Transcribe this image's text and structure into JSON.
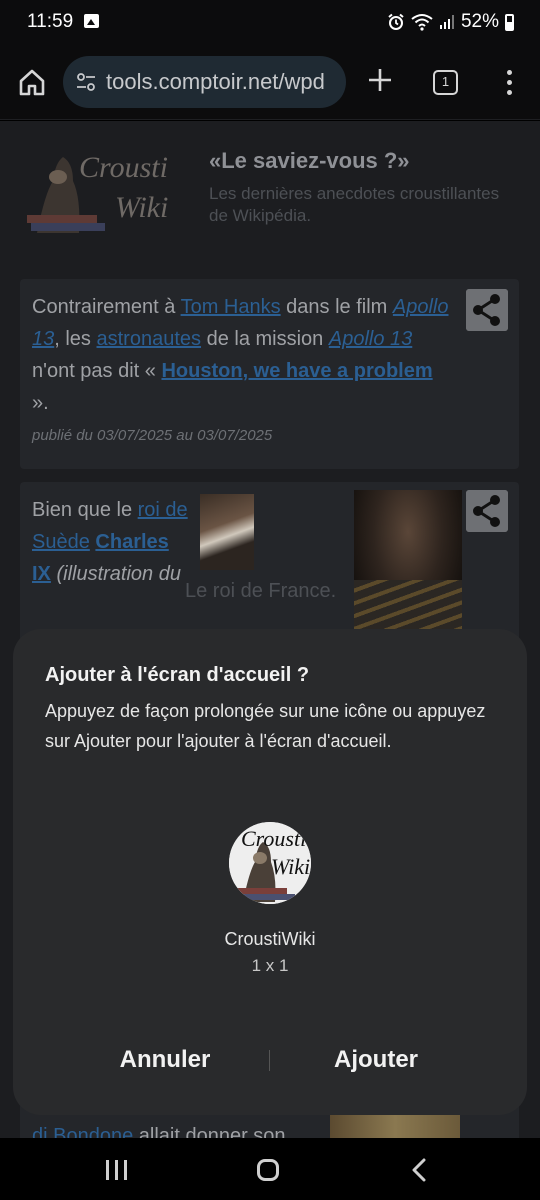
{
  "status_bar": {
    "time": "11:59",
    "battery": "52%"
  },
  "browser": {
    "url": "tools.comptoir.net/wpd",
    "tab_count": "1"
  },
  "page": {
    "logo_text_line1": "Crousti",
    "logo_text_line2": "Wiki",
    "title": "«Le saviez-vous ?»",
    "subtitle": "Les dernières anecdotes croustillantes de Wikipédia.",
    "card1": {
      "t1": "Contrairement à ",
      "l1": "Tom Hanks",
      "t2": " dans le film ",
      "l2": "Apollo 13",
      "t3": ", les ",
      "l3": "astronautes",
      "t4": " de la mission ",
      "l4": "Apollo 13",
      "t5": " n'ont pas dit « ",
      "l5": "Houston, we have a problem",
      "t6": " ».",
      "date": "publié du 03/07/2025 au 03/07/2025"
    },
    "card2": {
      "t1": "Bien que le ",
      "l1": "roi de Suède",
      "t2": " ",
      "l2": "Charles IX",
      "t3": " ",
      "t4": "(illustration du",
      "caption": "Le roi de France."
    },
    "card3": {
      "l1": "di Bondone",
      "t1": " allait donner son"
    }
  },
  "dialog": {
    "title": "Ajouter à l'écran d'accueil ?",
    "body": "Appuyez de façon prolongée sur une icône ou appuyez sur Ajouter pour l'ajouter à l'écran d'accueil.",
    "app_name": "CroustiWiki",
    "app_size": "1 x 1",
    "cancel_label": "Annuler",
    "add_label": "Ajouter"
  },
  "colors": {
    "link": "#2b5f93",
    "dialog_bg": "#292a2c",
    "page_bg": "#1c1d20"
  }
}
